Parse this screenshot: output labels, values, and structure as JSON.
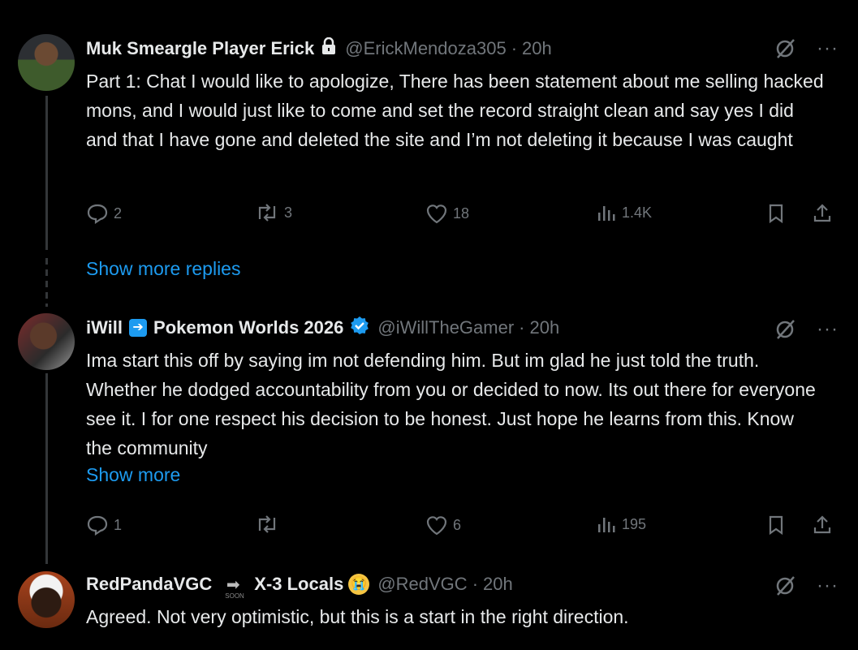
{
  "tweets": [
    {
      "name": "Muk Smeargle Player Erick",
      "handle": "@ErickMendoza305",
      "time": "20h",
      "text": "Part 1: Chat I would like to apologize, There has been statement about me selling hacked mons, and I would just like to come and set the record straight clean and say yes I did and that I have gone and deleted the site and I’m not deleting it because I was caught",
      "replies": "2",
      "reposts": "3",
      "likes": "18",
      "views": "1.4K"
    },
    {
      "name_part1": "iWill",
      "name_part2": "Pokemon Worlds 2026",
      "handle": "@iWillTheGamer",
      "time": "20h",
      "text": "Ima start this off by saying im not defending him. But im glad he just told the truth. Whether he dodged accountability from you or decided to now. Its out there for everyone see it. I for one respect his decision to be honest. Just hope he learns from this. Know the community",
      "show_more": "Show more",
      "replies": "1",
      "reposts": "",
      "likes": "6",
      "views": "195"
    },
    {
      "name_part1": "RedPandaVGC",
      "soon_label": "SOON",
      "name_part2": "X-3 Locals",
      "handle": "@RedVGC",
      "time": "20h",
      "text": "Agreed. Not very optimistic, but this is a start in the right direction."
    }
  ],
  "show_more_replies": "Show more replies",
  "separator": "·",
  "more_glyph": "···",
  "colors": {
    "accent": "#1d9bf0",
    "muted": "#71767b",
    "text": "#e7e9ea",
    "background": "#000000"
  }
}
